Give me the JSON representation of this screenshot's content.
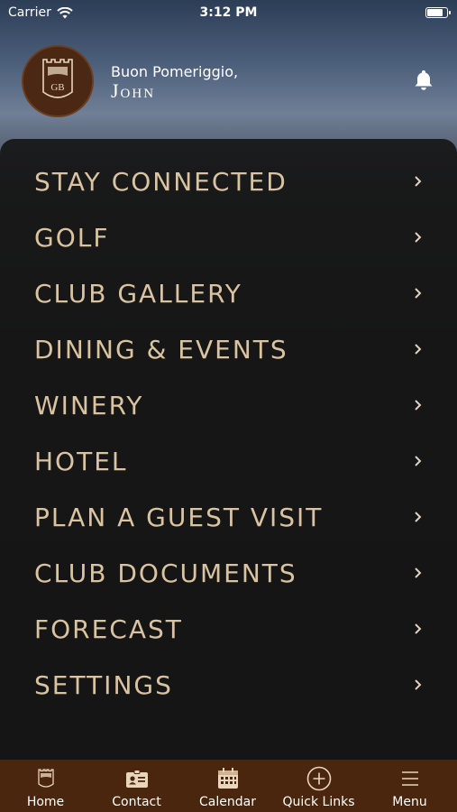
{
  "status_bar": {
    "carrier": "Carrier",
    "time": "3:12 PM",
    "battery_level": 0.9
  },
  "header": {
    "logo_text": "GB",
    "greeting": "Buon Pomeriggio,",
    "user_name": "John"
  },
  "menu": {
    "items": [
      {
        "label": "STAY CONNECTED"
      },
      {
        "label": "GOLF"
      },
      {
        "label": "CLUB GALLERY"
      },
      {
        "label": "DINING & EVENTS"
      },
      {
        "label": "WINERY"
      },
      {
        "label": "HOTEL"
      },
      {
        "label": "PLAN A GUEST VISIT"
      },
      {
        "label": "CLUB DOCUMENTS"
      },
      {
        "label": "FORECAST"
      },
      {
        "label": "SETTINGS"
      }
    ]
  },
  "tab_bar": {
    "tabs": [
      {
        "label": "Home",
        "icon": "logo-icon"
      },
      {
        "label": "Contact",
        "icon": "contact-card-icon"
      },
      {
        "label": "Calendar",
        "icon": "calendar-icon"
      },
      {
        "label": "Quick Links",
        "icon": "plus-circle-icon"
      },
      {
        "label": "Menu",
        "icon": "hamburger-icon"
      }
    ]
  },
  "colors": {
    "accent_text": "#d9c3a0",
    "tab_bar_bg": "#4a260f",
    "logo_bg": "#4b2814"
  }
}
